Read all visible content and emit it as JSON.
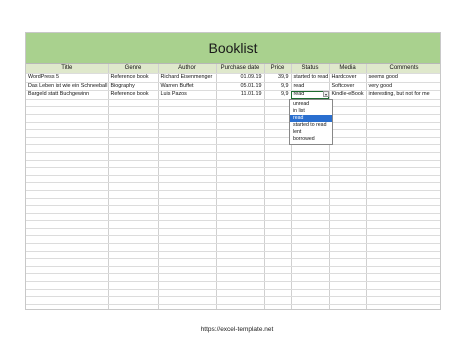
{
  "title": "Booklist",
  "columns": [
    "Title",
    "Genre",
    "Author",
    "Purchase date",
    "Price",
    "Status",
    "Media",
    "Comments"
  ],
  "rows": [
    [
      "WordPress 5",
      "Reference book",
      "Richard Eisenmenger",
      "01.09.19",
      "39,9",
      "started to read",
      "Hardcover",
      "seems good"
    ],
    [
      "Das Leben ist wie ein Schneeball",
      "Biography",
      "Warren Buffet",
      "05.01.19",
      "9,9",
      "read",
      "Softcover",
      "very good"
    ],
    [
      "Bargeld statt Buchgewinn",
      "Reference book",
      "Luis Pazos",
      "11.01.19",
      "9,9",
      "read",
      "Kindle-eBook",
      "interesting, but not for me"
    ]
  ],
  "status_dropdown": {
    "options": [
      "unread",
      "in list",
      "read",
      "started to read",
      "lent",
      "borrowed"
    ],
    "selected": "read"
  },
  "footer_url": "https://excel-template.net"
}
